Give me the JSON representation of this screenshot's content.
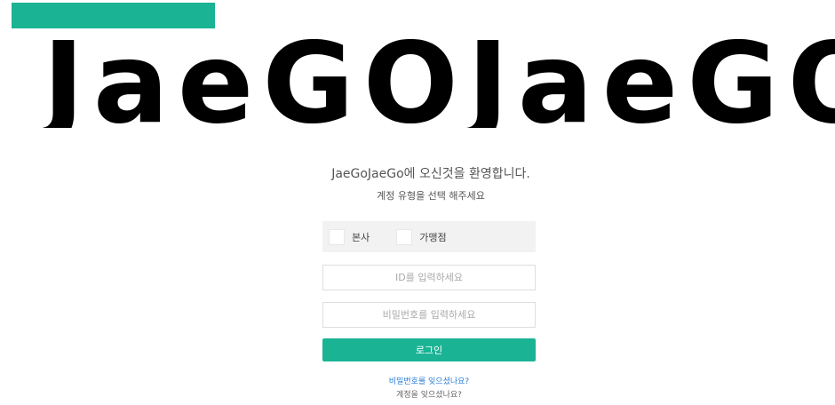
{
  "logo": {
    "text": "JaeGOJaeGO"
  },
  "welcome": {
    "title": "JaeGoJaeGo에 오신것을 환영합니다.",
    "subtitle": "계정 유형을 선택 해주세요"
  },
  "account_type": {
    "options": [
      {
        "label": "본사"
      },
      {
        "label": "가맹점"
      }
    ]
  },
  "login_form": {
    "id_placeholder": "ID를 입력하세요",
    "password_placeholder": "비밀번호를 입력하세요",
    "login_label": "로그인"
  },
  "links": {
    "forgot_password": "비밀번호를 잊으셨나요?",
    "forgot_account": "계정을 잊으셨나요?"
  },
  "colors": {
    "accent": "#1ab394",
    "link": "#2a7bd6",
    "panel": "#f2f2f2"
  }
}
